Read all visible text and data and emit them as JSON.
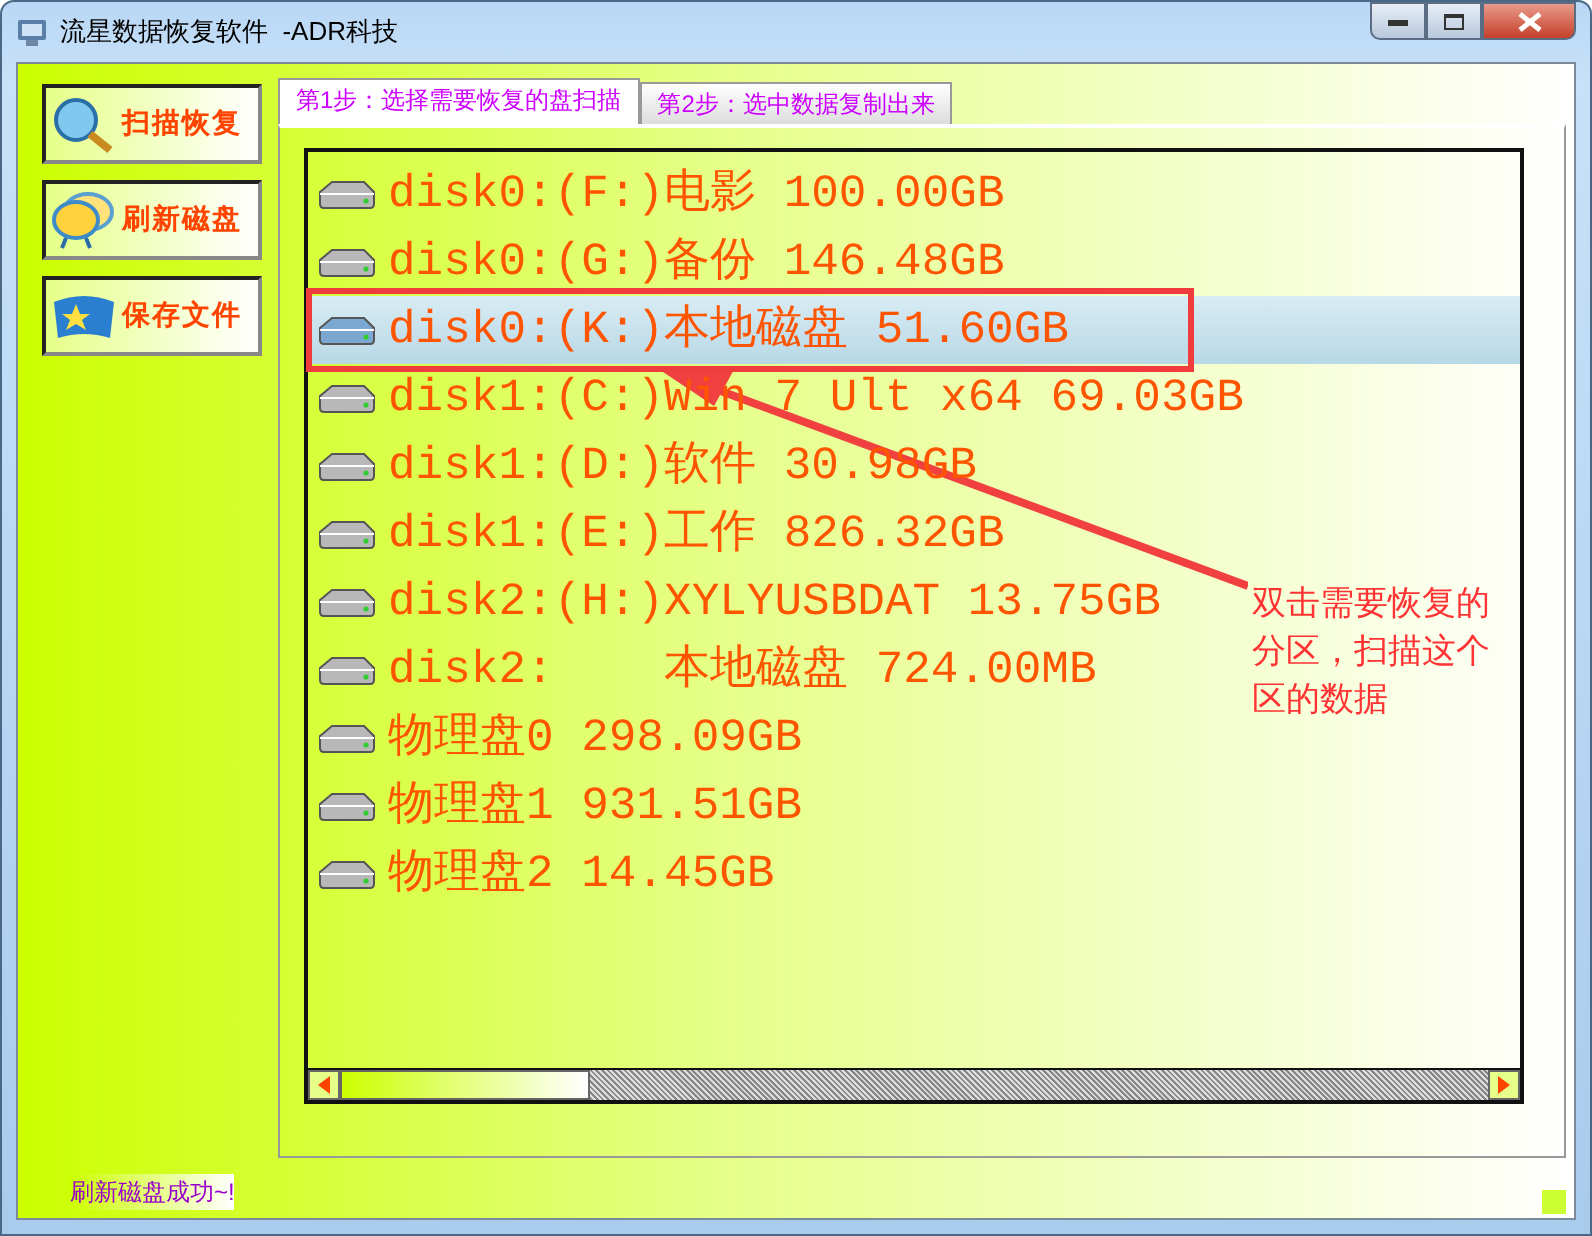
{
  "window": {
    "title": "流星数据恢复软件  -ADR科技"
  },
  "side_buttons": [
    {
      "label": "扫描恢复",
      "kind": "scan"
    },
    {
      "label": "刷新磁盘",
      "kind": "refresh"
    },
    {
      "label": "保存文件",
      "kind": "save"
    }
  ],
  "tabs": [
    {
      "label": "第1步：选择需要恢复的盘扫描",
      "selected": true
    },
    {
      "label": "第2步：选中数据复制出来",
      "selected": false
    }
  ],
  "disks": [
    {
      "label": "disk0:(F:)电影 100.00GB",
      "selected": false
    },
    {
      "label": "disk0:(G:)备份 146.48GB",
      "selected": false
    },
    {
      "label": "disk0:(K:)本地磁盘 51.60GB",
      "selected": true
    },
    {
      "label": "disk1:(C:)Win 7 Ult x64 69.03GB",
      "selected": false
    },
    {
      "label": "disk1:(D:)软件 30.98GB",
      "selected": false
    },
    {
      "label": "disk1:(E:)工作 826.32GB",
      "selected": false
    },
    {
      "label": "disk2:(H:)XYLYUSBDAT 13.75GB",
      "selected": false
    },
    {
      "label": "disk2:    本地磁盘 724.00MB",
      "selected": false
    },
    {
      "label": "物理盘0 298.09GB",
      "selected": false
    },
    {
      "label": "物理盘1 931.51GB",
      "selected": false
    },
    {
      "label": "物理盘2 14.45GB",
      "selected": false
    }
  ],
  "annotation": {
    "text": "双击需要恢复的分区，扫描这个区的数据"
  },
  "status_bar": {
    "text": "刷新磁盘成功~!"
  }
}
